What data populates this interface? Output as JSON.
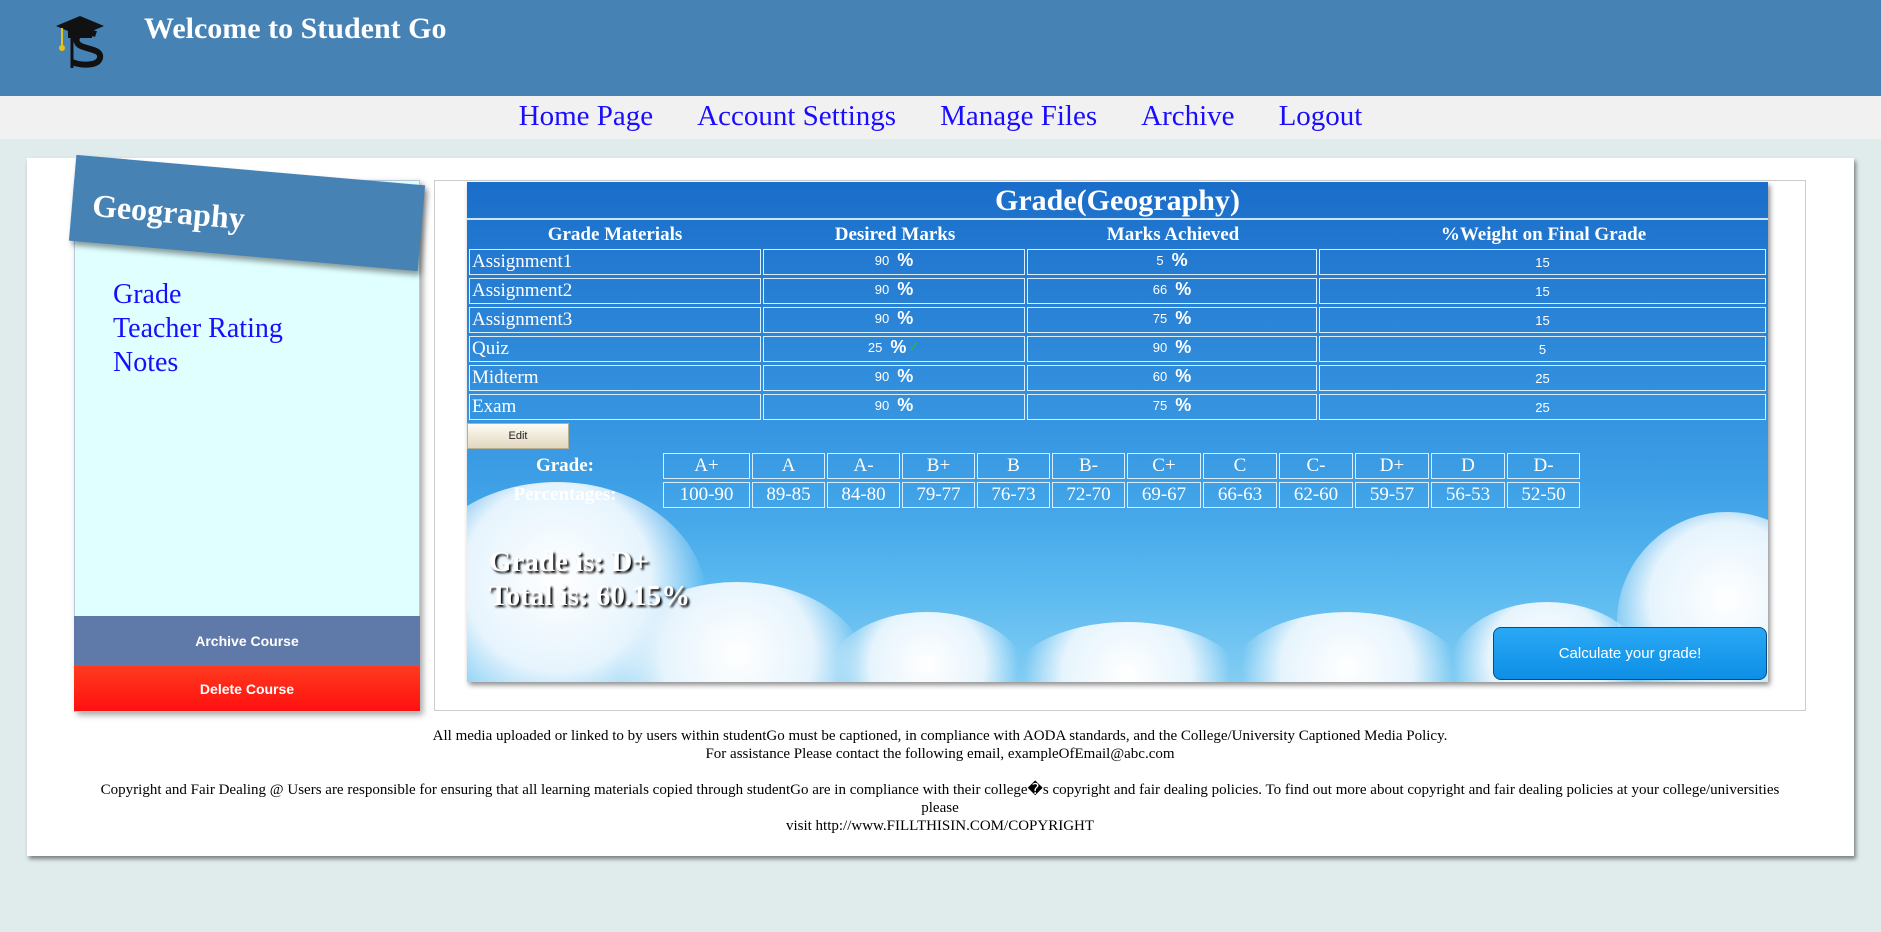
{
  "header": {
    "title": "Welcome to Student Go",
    "logo_icon": "graduation-cap-s-logo"
  },
  "nav": {
    "items": [
      "Home Page",
      "Account Settings",
      "Manage Files",
      "Archive",
      "Logout"
    ]
  },
  "sidebar": {
    "course_title": "Geography",
    "links": [
      "Grade",
      "Teacher Rating",
      "Notes"
    ],
    "archive_label": "Archive Course",
    "delete_label": "Delete Course"
  },
  "grade_table": {
    "title": "Grade(Geography)",
    "headers": [
      "Grade Materials",
      "Desired Marks",
      "Marks Achieved",
      "%Weight on Final Grade"
    ],
    "percent_symbol": "%",
    "check_symbol": "✓",
    "rows": [
      {
        "name": "Assignment1",
        "desired": "90",
        "achieved": "5",
        "weight": "15",
        "check": false
      },
      {
        "name": "Assignment2",
        "desired": "90",
        "achieved": "66",
        "weight": "15",
        "check": false
      },
      {
        "name": "Assignment3",
        "desired": "90",
        "achieved": "75",
        "weight": "15",
        "check": false
      },
      {
        "name": "Quiz",
        "desired": "25",
        "achieved": "90",
        "weight": "5",
        "check": true
      },
      {
        "name": "Midterm",
        "desired": "90",
        "achieved": "60",
        "weight": "25",
        "check": false
      },
      {
        "name": "Exam",
        "desired": "90",
        "achieved": "75",
        "weight": "25",
        "check": false
      }
    ],
    "edit_label": "Edit"
  },
  "grade_scale": {
    "grade_label": "Grade:",
    "percent_label": "Percentages:",
    "grades": [
      "A+",
      "A",
      "A-",
      "B+",
      "B",
      "B-",
      "C+",
      "C",
      "C-",
      "D+",
      "D",
      "D-"
    ],
    "ranges": [
      "100-90",
      "89-85",
      "84-80",
      "79-77",
      "76-73",
      "72-70",
      "69-67",
      "66-63",
      "62-60",
      "59-57",
      "56-53",
      "52-50"
    ]
  },
  "result": {
    "grade_text": "Grade is: D+",
    "total_text": "Total is: 60.15%",
    "calc_label": "Calculate your grade!"
  },
  "footer": {
    "line1": "All media uploaded or linked to by users within studentGo must be captioned, in compliance with AODA standards, and the College/University Captioned Media Policy.",
    "line2": "For assistance Please contact the following email, exampleOfEmail@abc.com",
    "line3": "Copyright and Fair Dealing @ Users are responsible for ensuring that all learning materials copied through studentGo are in compliance with their college�s copyright and fair dealing policies. To find out more about copyright and fair dealing policies at your college/universities please",
    "line4": "visit http://www.FILLTHISIN.COM/COPYRIGHT"
  },
  "colors": {
    "header_bg": "#4682b4",
    "link": "#1a0dff",
    "archive_btn": "#5f79a8",
    "delete_btn": "#ff1a14",
    "calc_btn": "#1a9bee"
  }
}
